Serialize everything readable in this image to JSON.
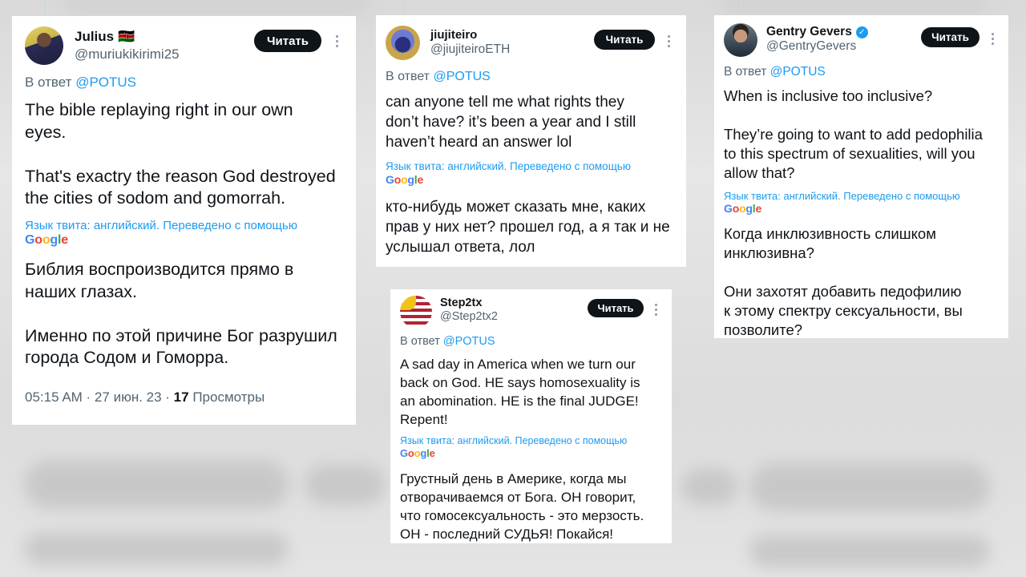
{
  "follow_label": "Читать",
  "reply_prefix": "В ответ",
  "translate_note": "Язык твита: английский. Переведено с помощью",
  "google_letters": [
    "G",
    "o",
    "o",
    "g",
    "l",
    "e"
  ],
  "cards": {
    "julius": {
      "name": "Julius",
      "flag": "🇰🇪",
      "handle": "@muriukikirimi25",
      "mention": "@POTUS",
      "original": "The bible replaying right in our own\neyes.\n\nThat's exactry the reason God destroyed\nthe cities of sodom and gomorrah.",
      "translation": "Библия воспроизводится прямо в\nнаших глазах.\n\nИменно по этой причине Бог разрушил\nгорода Содом и Гоморра.",
      "time": "05:15 AM · 27 июн. 23 · ",
      "views_count": "17",
      "views_label": " Просмотры"
    },
    "jiujiteiro": {
      "name": "jiujiteiro",
      "handle": "@jiujiteiroETH",
      "mention": "@POTUS",
      "original": "can anyone tell me what rights they\ndon’t have? it’s been a year and I still\nhaven’t heard an answer lol",
      "translation": "кто-нибудь может сказать мне, каких\nправ у них нет? прошел год, а я так и не\nуслышал ответа, лол"
    },
    "gentry": {
      "name": "Gentry Gevers",
      "verified_mark": "✓",
      "handle": "@GentryGevers",
      "mention": "@POTUS",
      "original": "When is inclusive too inclusive?\n\nThey’re going to want to add pedophilia\nto this spectrum of sexualities, will you\nallow that?",
      "translation": "Когда инклюзивность слишком\nинклюзивна?\n\nОни захотят добавить педофилию\nк этому спектру сексуальности, вы\nпозволите?"
    },
    "step2tx": {
      "name": "Step2tx",
      "handle": "@Step2tx2",
      "mention": "@POTUS",
      "original": "A sad day in America when we turn our\nback on God.  HE says homosexuality is\nan abomination. HE is the final JUDGE!\nRepent!",
      "translation": "Грустный день в Америке, когда мы\nотворачиваемся от Бога. ОН говорит,\nчто гомосексуальность - это мерзость.\nОН - последний СУДЬЯ! Покайся!"
    }
  },
  "colors": {
    "text": "#0f1419",
    "muted": "#536471",
    "link": "#1d9bf0",
    "button": "#0f1419"
  }
}
